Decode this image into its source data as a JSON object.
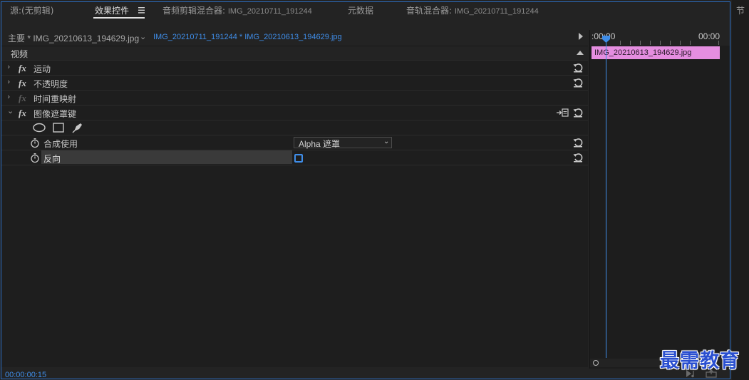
{
  "tabs": [
    {
      "label": "源:(无剪辑)",
      "sub": ""
    },
    {
      "label": "效果控件",
      "sub": ""
    },
    {
      "label": "音频剪辑混合器: ",
      "sub": "IMG_20210711_191244"
    },
    {
      "label": "元数据",
      "sub": ""
    },
    {
      "label": "音轨混合器: ",
      "sub": "IMG_20210711_191244"
    }
  ],
  "right_strip_char": "节",
  "clip_header": {
    "main_clip": "主要 * IMG_20210613_194629.jpg",
    "sequence_clip": "IMG_20210711_191244 * IMG_20210613_194629.jpg"
  },
  "section_video": "视频",
  "effects": [
    {
      "label": "运动"
    },
    {
      "label": "不透明度"
    },
    {
      "label": "时间重映射"
    },
    {
      "label": "图像遮罩键"
    }
  ],
  "fx_symbol": "fx",
  "properties": {
    "composite": {
      "label": "合成使用",
      "value": "Alpha 遮罩"
    },
    "invert": {
      "label": "反向",
      "checked": false
    }
  },
  "timeline": {
    "ruler_start": ":00:00",
    "ruler_end": "00:00",
    "clip_label": "IMG_20210613_194629.jpg",
    "clip_color": "#e58ee0"
  },
  "timecode": "00:00:00:15",
  "watermark": "最需教育",
  "accent_color": "#3f8de8",
  "icons": [
    "menu-icon",
    "ellipse-mask-icon",
    "rectangle-mask-icon",
    "pen-mask-icon",
    "stopwatch-icon",
    "reset-icon",
    "export-mask-icon",
    "play-audio-icon",
    "export-frame-icon"
  ]
}
